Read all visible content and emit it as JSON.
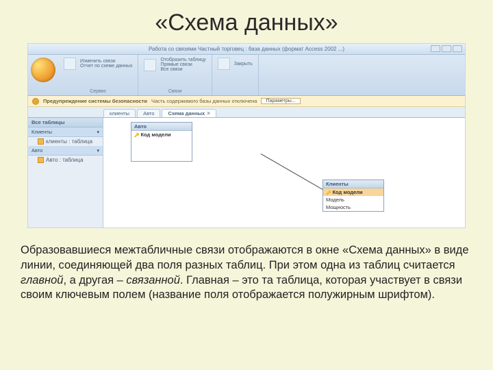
{
  "slide": {
    "title": "«Схема данных»"
  },
  "app": {
    "title_bar": "Работа со связями    Частный торговец : база данных (формат Access 2002 ...)",
    "ribbon": {
      "groups": {
        "g1_label": "Сервис",
        "g1_a": "Изменить связи",
        "g1_b": "Отчет по схеме данных",
        "g2_label": "Связи",
        "g2_a": "Отобразить таблицу",
        "g2_b": "Прямые связи",
        "g2_c": "Все связи",
        "g3_close": "Закрыть"
      }
    },
    "security": {
      "label": "Предупреждение системы безопасности",
      "msg": "Часть содержимого базы данных отключена",
      "button": "Параметры..."
    },
    "tabs": {
      "nav_label": "Все таблицы",
      "t1": "клиенты",
      "t2": "Авто",
      "t3": "Схема данных"
    },
    "nav": {
      "section1": "Клиенты",
      "item1": "клиенты : таблица",
      "section2": "Авто",
      "item2": "Авто : таблица"
    },
    "diagram": {
      "table1": {
        "title": "Авто",
        "f1": "Код модели"
      },
      "table2": {
        "title": "Клиенты",
        "f1": "Код модели",
        "f2": "Модель",
        "f3": "Мощность"
      }
    }
  },
  "body": {
    "p1a": "Образовавшиеся межтабличные связи отображаются в окне «Схема данных» в виде линии, соединяющей два поля разных таблиц. При этом одна из таблиц считается ",
    "p1b": "главной",
    "p1c": ", а другая – ",
    "p1d": "связанной",
    "p1e": ". Главная  – это та таблица, которая участвует в связи своим ключевым полем (название поля отображается полужирным шрифтом)."
  }
}
